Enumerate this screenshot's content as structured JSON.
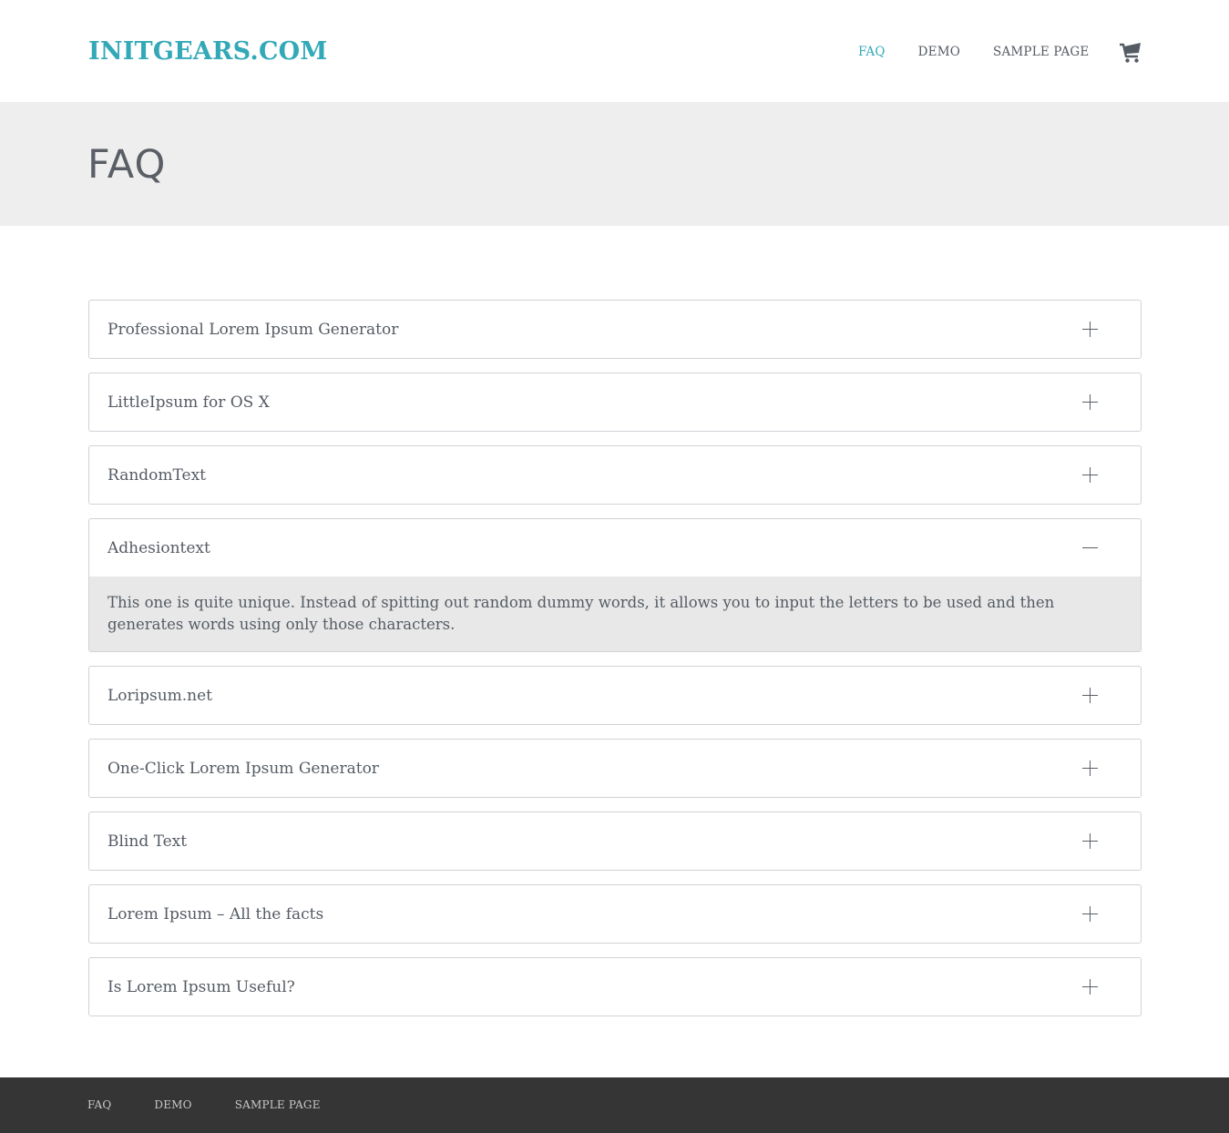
{
  "site": {
    "logo": "INITGEARS.COM"
  },
  "nav": {
    "items": [
      {
        "label": "FAQ",
        "active": true
      },
      {
        "label": "DEMO",
        "active": false
      },
      {
        "label": "SAMPLE PAGE",
        "active": false
      }
    ],
    "cart_icon": "shopping-cart-icon"
  },
  "hero": {
    "title": "FAQ"
  },
  "faq": {
    "items": [
      {
        "question": "Professional Lorem Ipsum Generator",
        "expanded": false
      },
      {
        "question": "LittleIpsum for OS X",
        "expanded": false
      },
      {
        "question": "RandomText",
        "expanded": false
      },
      {
        "question": "Adhesiontext",
        "expanded": true,
        "answer": "This one is quite unique. Instead of spitting out random dummy words, it allows you to input the letters to be used and then generates words using only those characters."
      },
      {
        "question": "Loripsum.net",
        "expanded": false
      },
      {
        "question": "One-Click Lorem Ipsum Generator",
        "expanded": false
      },
      {
        "question": "Blind Text",
        "expanded": false
      },
      {
        "question": "Lorem Ipsum – All the facts",
        "expanded": false
      },
      {
        "question": "Is Lorem Ipsum Useful?",
        "expanded": false
      }
    ]
  },
  "footer": {
    "links": [
      "FAQ",
      "DEMO",
      "SAMPLE PAGE"
    ]
  },
  "colors": {
    "accent": "#33a9b8",
    "footer_bg": "#353535",
    "hero_bg": "#eeeeee"
  }
}
